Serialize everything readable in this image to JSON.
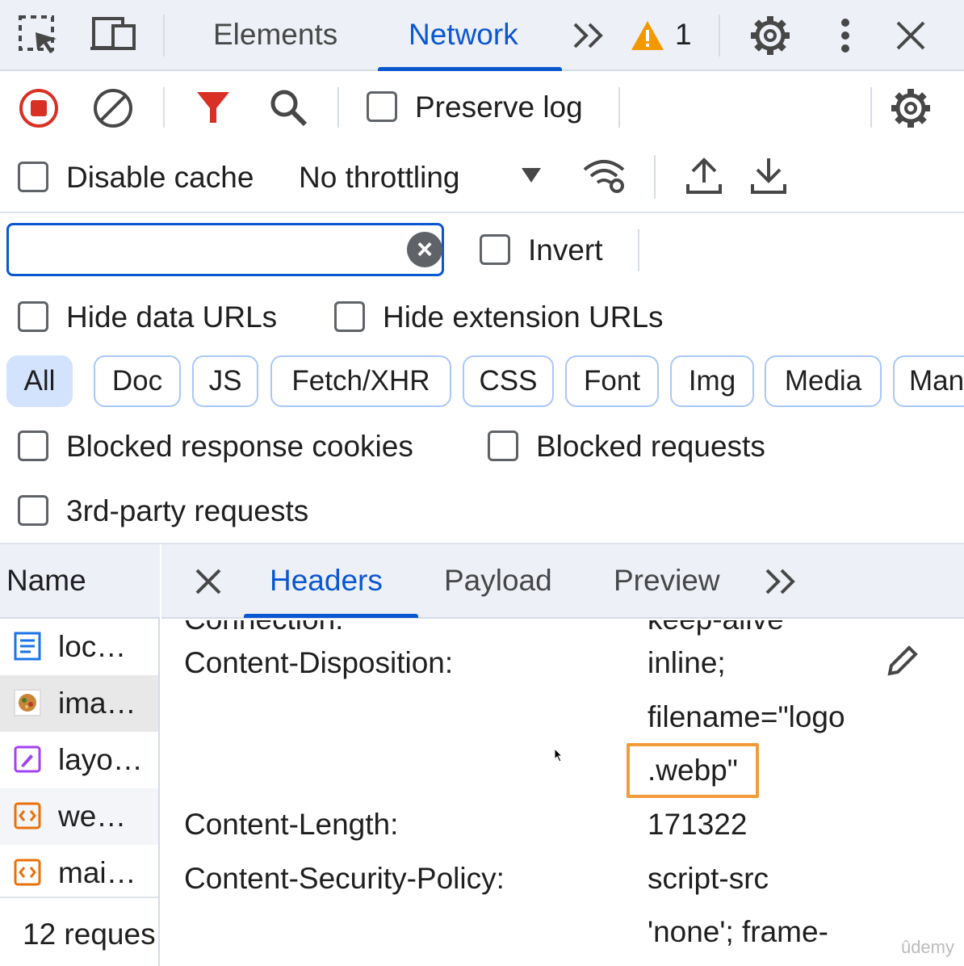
{
  "toolbar_top": {
    "tabs": [
      {
        "label": "Elements"
      },
      {
        "label": "Network"
      }
    ],
    "more_tabs_icon": "chevron-double-right-icon",
    "warning_count": "1",
    "colors": {
      "accent": "#0b57d0",
      "warning": "#f29900",
      "record": "#d93025",
      "filter": "#d93025"
    }
  },
  "network_toolbar": {
    "preserve_log_label": "Preserve log",
    "disable_cache_label": "Disable cache",
    "throttling_value": "No throttling"
  },
  "filter_bar": {
    "search_value": "",
    "invert_label": "Invert",
    "hide_data_urls_label": "Hide data URLs",
    "hide_extension_urls_label": "Hide extension URLs",
    "type_chips": [
      "All",
      "Doc",
      "JS",
      "Fetch/XHR",
      "CSS",
      "Font",
      "Img",
      "Media",
      "Man"
    ],
    "blocked_cookies_label": "Blocked response cookies",
    "blocked_requests_label": "Blocked requests",
    "third_party_label": "3rd-party requests"
  },
  "request_list": {
    "header": "Name",
    "items": [
      {
        "name": "loc…",
        "icon": "document-icon"
      },
      {
        "name": "ima…",
        "icon": "image-thumbnail-icon"
      },
      {
        "name": "layo…",
        "icon": "css-icon"
      },
      {
        "name": "we…",
        "icon": "script-icon"
      },
      {
        "name": "mai…",
        "icon": "script-icon"
      }
    ],
    "status": "12 reques"
  },
  "details": {
    "tabs": [
      {
        "label": "Headers"
      },
      {
        "label": "Payload"
      },
      {
        "label": "Preview"
      }
    ],
    "partial_top_key": "Connection:",
    "partial_top_value": "keep-alive",
    "headers": [
      {
        "key": "Content-Disposition:",
        "value_lines": [
          "inline;",
          "filename=\"logo",
          ".webp\""
        ]
      },
      {
        "key": "Content-Length:",
        "value_lines": [
          "171322"
        ]
      },
      {
        "key": "Content-Security-Policy:",
        "value_lines": [
          "script-src",
          "'none'; frame-"
        ]
      }
    ]
  },
  "watermark": "ûdemy"
}
